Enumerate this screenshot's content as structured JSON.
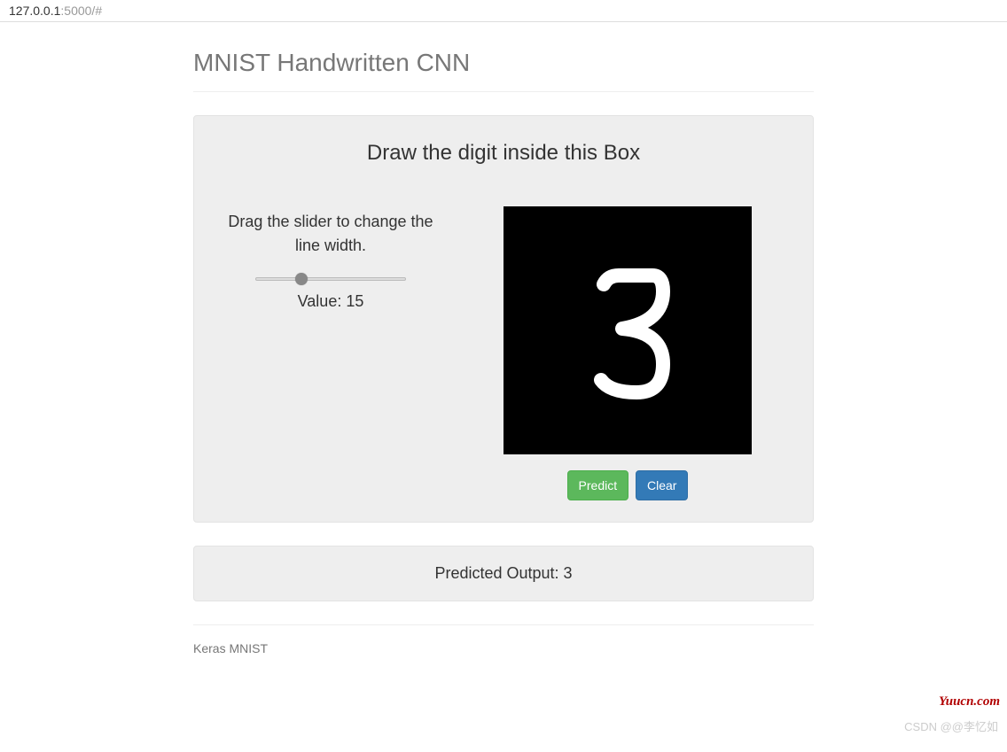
{
  "address": {
    "host": "127.0.0.1",
    "path": ":5000/#"
  },
  "page": {
    "title": "MNIST Handwritten CNN"
  },
  "panel": {
    "heading": "Draw the digit inside this Box",
    "slider_label": "Drag the slider to change the line width.",
    "slider_value_prefix": "Value: ",
    "slider_value": "15",
    "buttons": {
      "predict": "Predict",
      "clear": "Clear"
    }
  },
  "output": {
    "label": "Predicted Output: ",
    "value": "3"
  },
  "footer": {
    "text": "Keras MNIST"
  },
  "watermarks": {
    "site": "Yuucn.com",
    "author": "CSDN @@李忆如"
  }
}
